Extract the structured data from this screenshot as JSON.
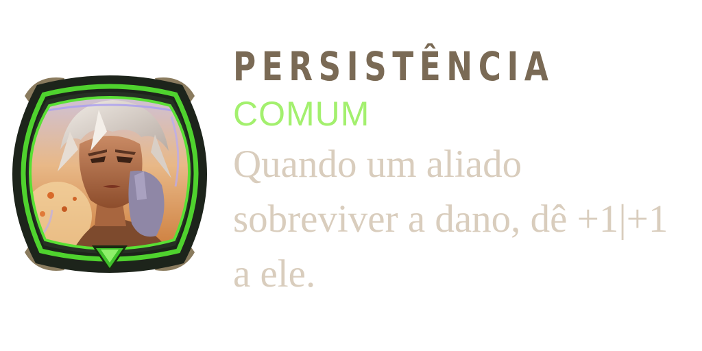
{
  "card": {
    "title": "PERSISTÊNCIA",
    "rarity": "COMUM",
    "description": "Quando um aliado sobreviver a dano, dê +1|+1 a ele.",
    "portrait": "champion-portrait",
    "rarity_gem_icon": "green-triangle-gem-icon"
  },
  "colors": {
    "title": "#7a6a55",
    "rarity": "#a3f06e",
    "description": "#d9cdbd",
    "frame_green": "#4fd22e",
    "frame_dark": "#1d241b"
  }
}
